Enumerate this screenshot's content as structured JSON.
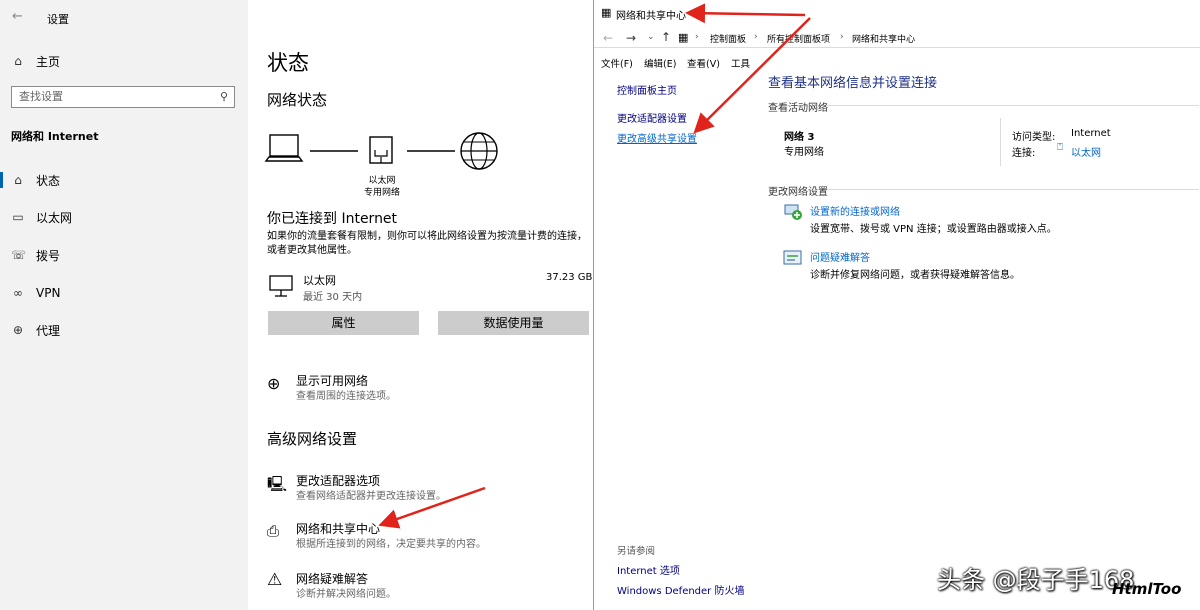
{
  "settings": {
    "title": "设置",
    "nav_home": "主页",
    "search_placeholder": "查找设置",
    "section": "网络和 Internet",
    "nav_items": [
      {
        "label": "状态",
        "icon": "home-status-icon"
      },
      {
        "label": "以太网",
        "icon": "ethernet-icon"
      },
      {
        "label": "拨号",
        "icon": "dialup-icon"
      },
      {
        "label": "VPN",
        "icon": "vpn-icon"
      },
      {
        "label": "代理",
        "icon": "globe-icon"
      }
    ],
    "page_title": "状态",
    "network_status_heading": "网络状态",
    "diagram_label_line1": "以太网",
    "diagram_label_line2": "专用网络",
    "connected_heading": "你已连接到 Internet",
    "connected_desc": "如果你的流量套餐有限制，则你可以将此网络设置为按流量计费的连接，或者更改其他属性。",
    "connection": {
      "name": "以太网",
      "period": "最近 30 天内",
      "usage": "37.23 GB"
    },
    "button_properties": "属性",
    "button_data_usage": "数据使用量",
    "show_networks_title": "显示可用网络",
    "show_networks_sub": "查看周围的连接选项。",
    "advanced_heading": "高级网络设置",
    "advanced_items": [
      {
        "title": "更改适配器选项",
        "sub": "查看网络适配器并更改连接设置。"
      },
      {
        "title": "网络和共享中心",
        "sub": "根据所连接到的网络，决定要共享的内容。"
      },
      {
        "title": "网络疑难解答",
        "sub": "诊断并解决网络问题。"
      }
    ]
  },
  "control_panel": {
    "window_title": "网络和共享中心",
    "breadcrumb": [
      "控制面板",
      "所有控制面板项",
      "网络和共享中心"
    ],
    "menu": [
      "文件(F)",
      "编辑(E)",
      "查看(V)",
      "工具"
    ],
    "sidebar_links": [
      "控制面板主页",
      "更改适配器设置",
      "更改高级共享设置"
    ],
    "see_also_heading": "另请参阅",
    "see_also_links": [
      "Internet 选项",
      "Windows Defender 防火墙"
    ],
    "main_heading": "查看基本网络信息并设置连接",
    "active_networks_heading": "查看活动网络",
    "network_name": "网络 3",
    "network_type": "专用网络",
    "access_type_label": "访问类型:",
    "access_type_value": "Internet",
    "connections_label": "连接:",
    "connections_value": "以太网",
    "change_settings_heading": "更改网络设置",
    "tasks": [
      {
        "title": "设置新的连接或网络",
        "sub": "设置宽带、拨号或 VPN 连接；或设置路由器或接入点。"
      },
      {
        "title": "问题疑难解答",
        "sub": "诊断并修复网络问题，或者获得疑难解答信息。"
      }
    ]
  },
  "watermark": {
    "text": "头条 @段子手168",
    "brand": "HtmlToo"
  },
  "colors": {
    "accent": "#0063b1",
    "link": "#0066cc",
    "arrow": "#e0231b"
  }
}
